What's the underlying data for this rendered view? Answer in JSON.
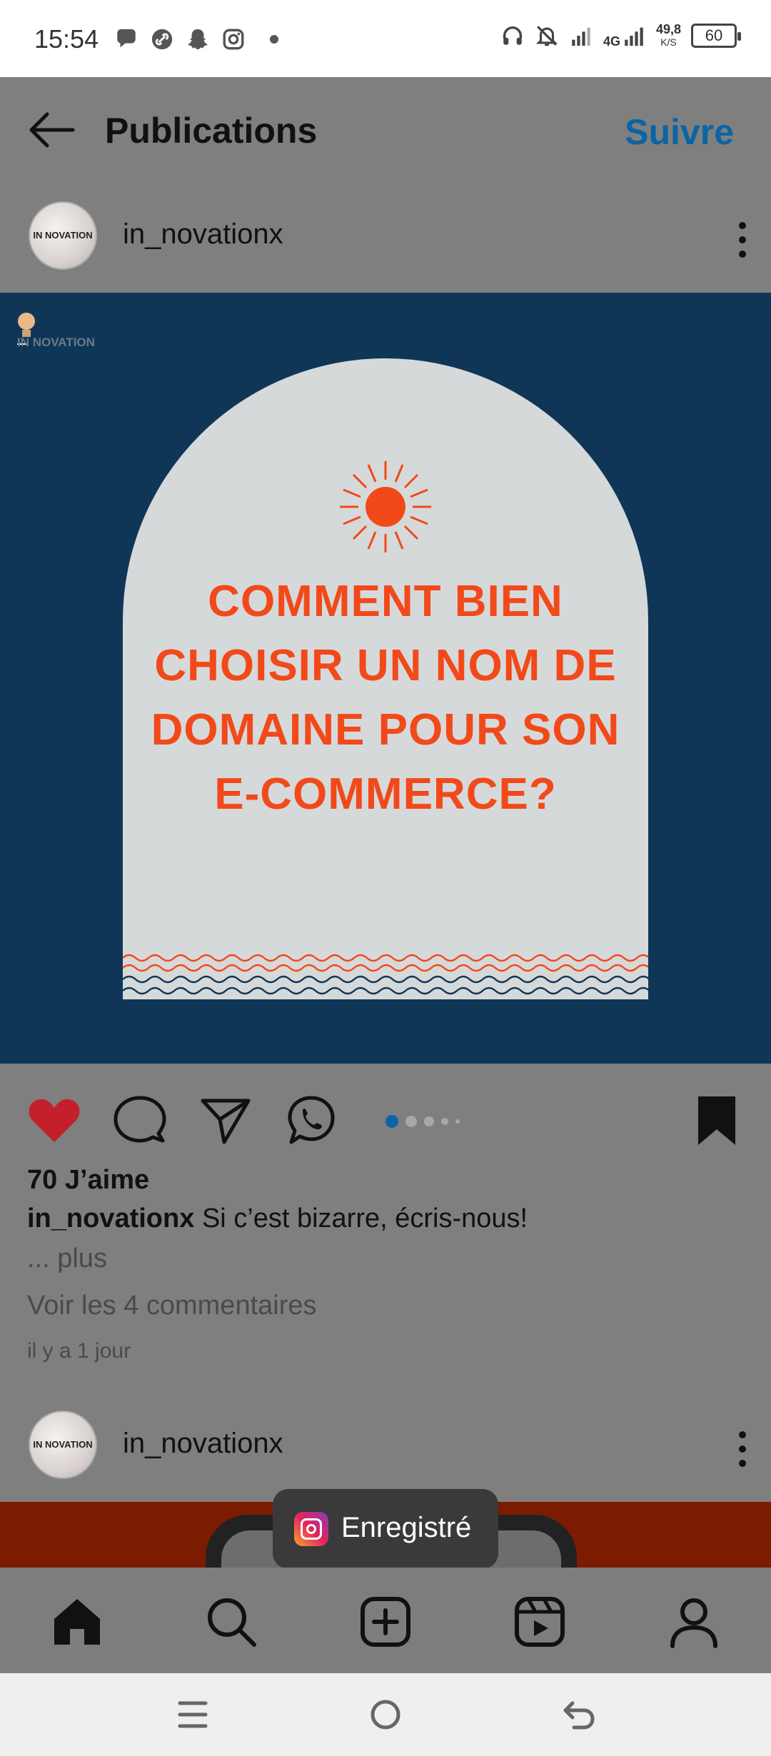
{
  "status_bar": {
    "time": "15:54",
    "network_type": "4G",
    "speed_value": "49,8",
    "speed_unit": "K/S",
    "battery": "60",
    "left_icons": [
      "messages-icon",
      "link-icon",
      "snapchat-icon",
      "instagram-icon"
    ],
    "right_icons": [
      "headphones-icon",
      "bell-off-icon",
      "signal-icon",
      "signal-4g-icon"
    ]
  },
  "header": {
    "title": "Publications",
    "follow_label": "Suivre",
    "follow_color": "#0a64a5"
  },
  "post": {
    "username": "in_novationx",
    "avatar_text": "IN NOVATION",
    "image": {
      "logo_text": "IN NOVATION",
      "title": "COMMENT BIEN CHOISIR UN NOM DE DOMAINE POUR SON E-COMMERCE?",
      "title_color": "#f2491a",
      "background_color": "#0f3657"
    },
    "liked": true,
    "saved": true,
    "carousel": {
      "count": 5,
      "active_index": 0
    },
    "likes_text": "70 J’aime",
    "caption_user": "in_novationx",
    "caption_text": "Si c’est bizarre, écris-nous!",
    "more_label": "... plus",
    "comments_label": "Voir les 4 commentaires",
    "time_ago": "il y a 1 jour"
  },
  "next_post": {
    "username": "in_novationx",
    "avatar_text": "IN NOVATION"
  },
  "toast": {
    "text": "Enregistré"
  },
  "bottom_nav": [
    "home-icon",
    "search-icon",
    "create-icon",
    "reels-icon",
    "profile-icon"
  ],
  "system_nav": [
    "menu-icon",
    "home-circle-icon",
    "back-icon"
  ]
}
